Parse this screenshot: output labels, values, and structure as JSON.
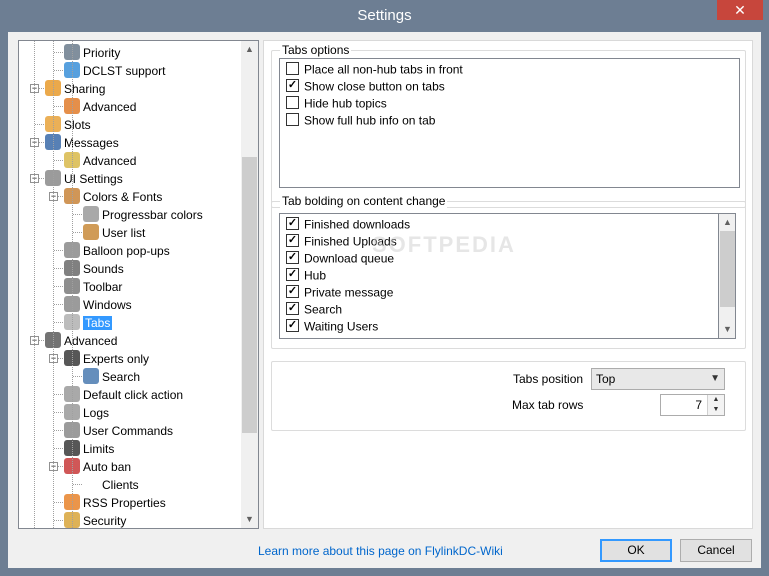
{
  "window": {
    "title": "Settings",
    "close_glyph": "✕"
  },
  "tree": {
    "items": [
      {
        "label": "Priority",
        "icon": "priority-icon",
        "level": 2,
        "color": "#6b7b8c"
      },
      {
        "label": "DCLST support",
        "icon": "dclst-icon",
        "level": 2,
        "color": "#3a8fd8"
      },
      {
        "label": "Sharing",
        "icon": "sharing-icon",
        "level": 1,
        "color": "#e89a2c",
        "expander": "−"
      },
      {
        "label": "Advanced",
        "icon": "sharing-advanced-icon",
        "level": 2,
        "color": "#e07b2a"
      },
      {
        "label": "Slots",
        "icon": "slots-icon",
        "level": 1,
        "color": "#e8a23a"
      },
      {
        "label": "Messages",
        "icon": "messages-icon",
        "level": 1,
        "color": "#3a6aa8",
        "expander": "−"
      },
      {
        "label": "Advanced",
        "icon": "messages-advanced-icon",
        "level": 2,
        "color": "#d8b84a"
      },
      {
        "label": "UI Settings",
        "icon": "ui-settings-icon",
        "level": 1,
        "color": "#8a8a8a",
        "expander": "−"
      },
      {
        "label": "Colors & Fonts",
        "icon": "palette-icon",
        "level": 2,
        "color": "#c8843a",
        "expander": "−"
      },
      {
        "label": "Progressbar colors",
        "icon": "progressbar-icon",
        "level": 3,
        "color": "#9a9a9a"
      },
      {
        "label": "User list",
        "icon": "user-list-icon",
        "level": 3,
        "color": "#c88a3a"
      },
      {
        "label": "Balloon pop-ups",
        "icon": "balloon-icon",
        "level": 2,
        "color": "#8a8a8a"
      },
      {
        "label": "Sounds",
        "icon": "speaker-icon",
        "level": 2,
        "color": "#6a6a6a"
      },
      {
        "label": "Toolbar",
        "icon": "toolbar-icon",
        "level": 2,
        "color": "#7a7a7a"
      },
      {
        "label": "Windows",
        "icon": "windows-icon",
        "level": 2,
        "color": "#8a8a8a"
      },
      {
        "label": "Tabs",
        "icon": "tabs-icon",
        "level": 2,
        "color": "#b0b0b0",
        "selected": true
      },
      {
        "label": "Advanced",
        "icon": "tools-icon",
        "level": 1,
        "color": "#5a5a5a",
        "expander": "−"
      },
      {
        "label": "Experts only",
        "icon": "expert-icon",
        "level": 2,
        "color": "#3a3a3a",
        "expander": "−"
      },
      {
        "label": "Search",
        "icon": "search-icon",
        "level": 3,
        "color": "#4a7ab0"
      },
      {
        "label": "Default click action",
        "icon": "mouse-icon",
        "level": 2,
        "color": "#9a9a9a"
      },
      {
        "label": "Logs",
        "icon": "logs-icon",
        "level": 2,
        "color": "#9a9a9a"
      },
      {
        "label": "User Commands",
        "icon": "user-commands-icon",
        "level": 2,
        "color": "#8a8a8a"
      },
      {
        "label": "Limits",
        "icon": "limits-icon",
        "level": 2,
        "color": "#3a3a3a"
      },
      {
        "label": "Auto ban",
        "icon": "auto-ban-icon",
        "level": 2,
        "color": "#c83a3a",
        "expander": "−"
      },
      {
        "label": "Clients",
        "icon": "",
        "level": 3,
        "color": ""
      },
      {
        "label": "RSS Properties",
        "icon": "rss-icon",
        "level": 2,
        "color": "#e8832a"
      },
      {
        "label": "Security",
        "icon": "lock-icon",
        "level": 2,
        "color": "#d8a43a"
      }
    ]
  },
  "tabs_options": {
    "title": "Tabs options",
    "items": [
      {
        "label": "Place all non-hub tabs in front",
        "checked": false
      },
      {
        "label": "Show close button on tabs",
        "checked": true
      },
      {
        "label": "Hide hub topics",
        "checked": false
      },
      {
        "label": "Show full hub info on tab",
        "checked": false
      }
    ]
  },
  "tab_bolding": {
    "title": "Tab bolding on content change",
    "items": [
      {
        "label": "Finished downloads",
        "checked": true
      },
      {
        "label": "Finished Uploads",
        "checked": true
      },
      {
        "label": "Download queue",
        "checked": true
      },
      {
        "label": "Hub",
        "checked": true
      },
      {
        "label": "Private message",
        "checked": true
      },
      {
        "label": "Search",
        "checked": true
      },
      {
        "label": "Waiting Users",
        "checked": true
      }
    ]
  },
  "tabs_position": {
    "label": "Tabs position",
    "value": "Top"
  },
  "max_tab_rows": {
    "label": "Max tab rows",
    "value": "7"
  },
  "footer": {
    "link": "Learn more about this page on FlylinkDC-Wiki",
    "ok": "OK",
    "cancel": "Cancel"
  },
  "watermark": "SOFTPEDIA"
}
